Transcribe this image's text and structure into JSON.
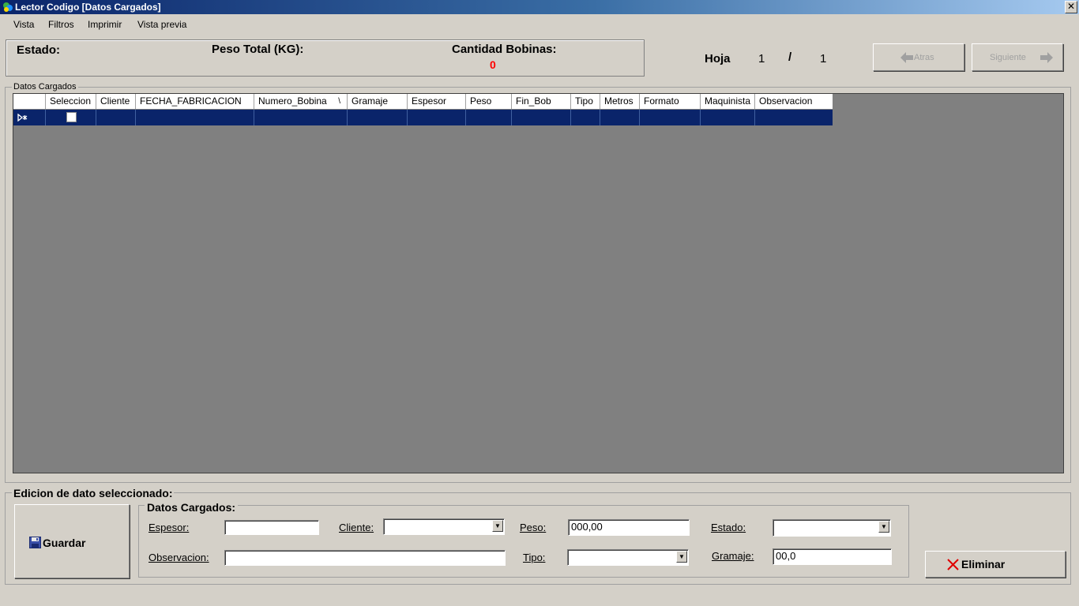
{
  "window": {
    "title": "Lector Codigo [Datos Cargados]",
    "close_glyph": "✕"
  },
  "menu": [
    "Vista",
    "Filtros",
    "Imprimir",
    "Vista previa"
  ],
  "status": {
    "estado_label": "Estado:",
    "peso_total_label": "Peso Total (KG):",
    "cantidad_bobinas_label": "Cantidad Bobinas:",
    "cantidad_bobinas_value": "0",
    "cantidad_color": "#ff0000"
  },
  "pager": {
    "hoja_label": "Hoja",
    "current": "1",
    "separator": "/",
    "total": "1",
    "back_label": "Atras",
    "next_label": "Siguiente"
  },
  "grid": {
    "title": "Datos Cargados",
    "columns": [
      "",
      "Seleccion",
      "Cliente",
      "FECHA_FABRICACION",
      "Numero_Bobina",
      "Gramaje",
      "Espesor",
      "Peso",
      "Fin_Bob",
      "Tipo",
      "Metros",
      "Formato",
      "Maquinista",
      "Observacion"
    ],
    "sort_glyph": "\\",
    "selected_row_color": "#0a246a"
  },
  "edit": {
    "title": "Edicion de dato seleccionado:",
    "save_label": "Guardar",
    "delete_label": "Eliminar",
    "group_title": "Datos Cargados:",
    "espesor_label": "Espesor:",
    "espesor_value": "",
    "cliente_label": "Cliente:",
    "cliente_value": "",
    "peso_label": "Peso:",
    "peso_value": "000,00",
    "estado_label": "Estado:",
    "estado_value": "",
    "observacion_label": "Observacion:",
    "observacion_value": "",
    "tipo_label": "Tipo:",
    "tipo_value": "",
    "gramaje_label": "Gramaje:",
    "gramaje_value": "00,0"
  }
}
